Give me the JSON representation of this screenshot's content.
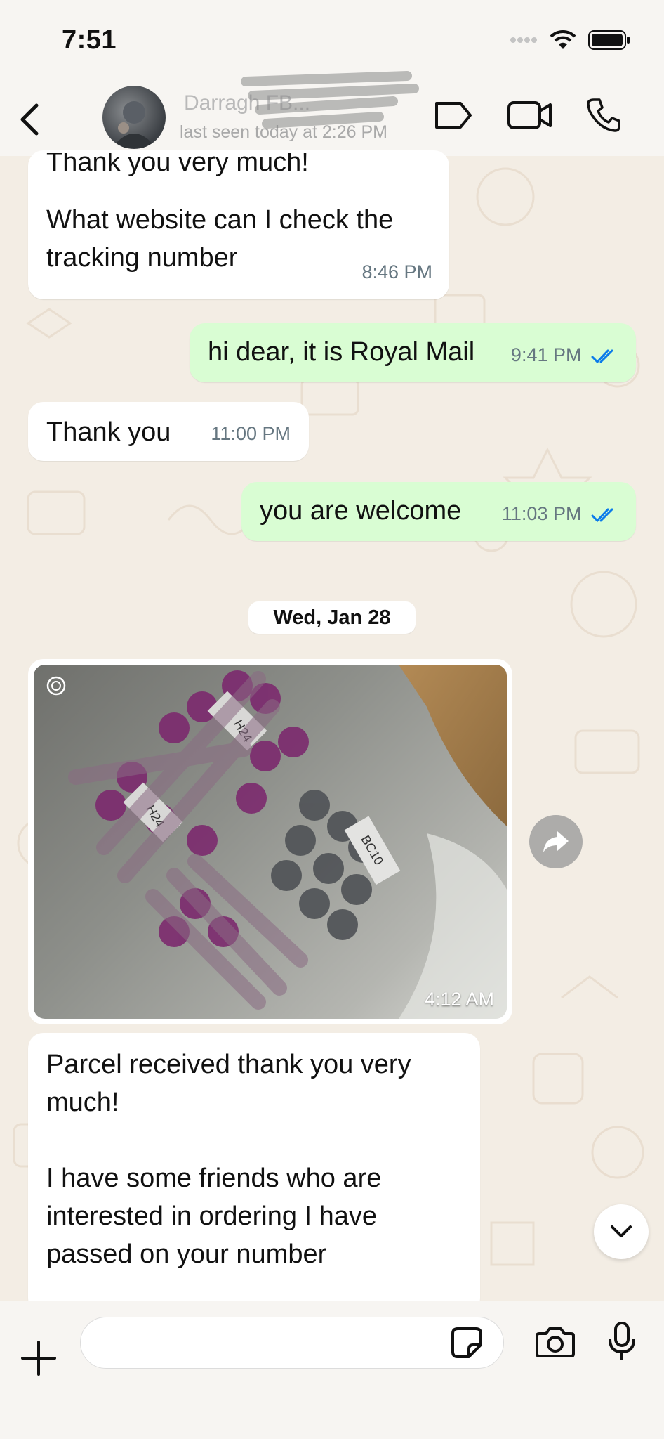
{
  "status_bar": {
    "time": "7:51"
  },
  "header": {
    "contact_name": "Darragh FB...",
    "contact_status": "last seen today at 2:26 PM"
  },
  "messages": [
    {
      "direction": "in",
      "lines": [
        "Thank you very much!",
        "",
        "What website can I check the",
        "tracking number"
      ],
      "time": "8:46 PM"
    },
    {
      "direction": "out",
      "text": "hi dear, it is Royal Mail",
      "time": "9:41 PM",
      "read": true
    },
    {
      "direction": "in",
      "text": "Thank you",
      "time": "11:00 PM"
    },
    {
      "direction": "out",
      "text": "you are welcome",
      "time": "11:03 PM",
      "read": true
    }
  ],
  "date_divider": "Wed, Jan 28",
  "image_message": {
    "time": "4:12 AM",
    "labels": [
      "H24",
      "H24",
      "BC10"
    ]
  },
  "last_message": {
    "lines": [
      "Parcel received thank you very",
      "much!",
      "",
      "I have some friends who are",
      "interested in ordering I have",
      "passed on your number"
    ]
  },
  "composer": {
    "placeholder": ""
  },
  "colors": {
    "outgoing_bubble": "#d9fdd3",
    "incoming_bubble": "#ffffff",
    "read_ticks": "#0b7bea"
  }
}
